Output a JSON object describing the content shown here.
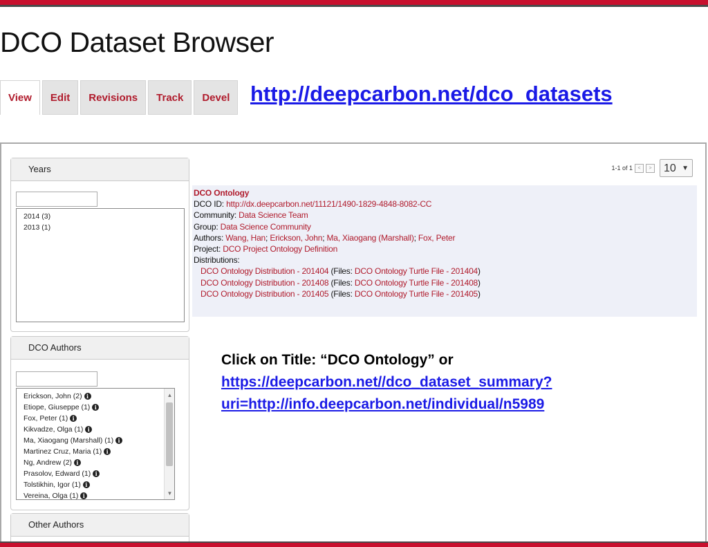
{
  "title": "DCO Dataset Browser",
  "tabs": [
    {
      "label": "View",
      "active": true
    },
    {
      "label": "Edit"
    },
    {
      "label": "Revisions"
    },
    {
      "label": "Track"
    },
    {
      "label": "Devel"
    }
  ],
  "top_link": "http://deepcarbon.net/dco_datasets",
  "facets": {
    "years": {
      "header": "Years",
      "items": [
        "2014 (3)",
        "2013 (1)"
      ]
    },
    "dco_authors": {
      "header": "DCO Authors",
      "items": [
        "Erickson, John (2)",
        "Etiope, Giuseppe (1)",
        "Fox, Peter (1)",
        "Kikvadze, Olga (1)",
        "Ma, Xiaogang (Marshall) (1)",
        "Martinez Cruz, Maria (1)",
        "Ng, Andrew (2)",
        "Prasolov, Edward (1)",
        "Tolstikhin, Igor (1)",
        "Vereina, Olga (1)"
      ]
    },
    "other_authors": {
      "header": "Other Authors"
    }
  },
  "pager": {
    "range": "1-1 of 1",
    "prev": "<",
    "next": ">",
    "per_page": "10"
  },
  "result": {
    "title": "DCO Ontology",
    "id_label": "DCO ID:",
    "id_value": "http://dx.deepcarbon.net/11121/1490-1829-4848-8082-CC",
    "community_label": "Community:",
    "community_value": "Data Science Team",
    "group_label": "Group:",
    "group_value": "Data Science Community",
    "authors_label": "Authors:",
    "authors": [
      "Wang, Han",
      "Erickson, John",
      "Ma, Xiaogang (Marshall)",
      "Fox, Peter"
    ],
    "sep": ";",
    "project_label": "Project:",
    "project_value": "DCO Project Ontology Definition",
    "distributions_label": "Distributions:",
    "files_open": "(Files:",
    "files_close": ")",
    "distributions": [
      {
        "name": "DCO Ontology Distribution - 201404",
        "file": "DCO Ontology Turtle File - 201404"
      },
      {
        "name": "DCO Ontology Distribution - 201408",
        "file": "DCO Ontology Turtle File - 201408"
      },
      {
        "name": "DCO Ontology Distribution - 201405",
        "file": "DCO Ontology Turtle File - 201405"
      }
    ]
  },
  "annotation": {
    "line1": "Click on Title: “DCO Ontology” or",
    "link_line1": "https://deepcarbon.net//dco_dataset_summary?",
    "link_line2": "uri=http://info.deepcarbon.net/individual/n5989"
  },
  "colors": {
    "brand_red": "#c8102e",
    "link_red": "#b01b2c",
    "link_blue": "#1a1ae6"
  },
  "icons": {
    "info": "info-circle-icon",
    "scroll_up": "scroll-up-arrow-icon",
    "scroll_down": "scroll-down-arrow-icon",
    "dropdown": "chevron-down-icon"
  }
}
